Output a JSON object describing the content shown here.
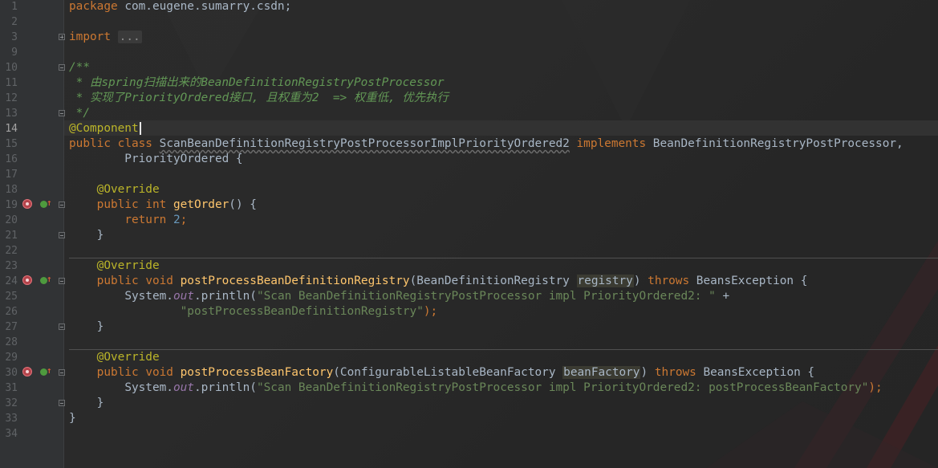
{
  "editor": {
    "current_line": 14,
    "line_numbers": [
      "1",
      "2",
      "3",
      "9",
      "10",
      "11",
      "12",
      "13",
      "14",
      "15",
      "16",
      "17",
      "18",
      "19",
      "20",
      "21",
      "22",
      "23",
      "24",
      "25",
      "26",
      "27",
      "28",
      "29",
      "30",
      "31",
      "32",
      "33",
      "34"
    ],
    "lines": {
      "l1": {
        "kw": "package",
        "text": " com.eugene.sumarry.csdn;"
      },
      "l3": {
        "kw": "import",
        "folded": "..."
      },
      "l9": {
        "text": "/**"
      },
      "l10": {
        "a": " * 由",
        "b": "spring",
        "c": "扫描出来的",
        "d": "BeanDefinitionRegistryPostProcessor"
      },
      "l11": {
        "a": " * 实现了",
        "b": "PriorityOrdered",
        "c": "接口, 且权重为",
        "d": "2",
        "e": "  => 权重低, 优先执行"
      },
      "l12": {
        "text": " */"
      },
      "l13": {
        "ann": "@Component"
      },
      "l14": {
        "kw1": "public",
        "kw2": "class",
        "cls": "ScanBeanDefinitionRegistryPostProcessorImplPriorityOrdered2",
        "kw3": "implements",
        "rest": " BeanDefinitionRegistryPostProcessor,"
      },
      "l15": {
        "text": "        PriorityOrdered {"
      },
      "l17": {
        "ann": "@Override"
      },
      "l18": {
        "kw1": "public",
        "kw2": "int",
        "fn": "getOrder",
        "rest": "() {"
      },
      "l19": {
        "kw": "return",
        "num": "2",
        "rest": ";"
      },
      "l20": {
        "text": "}"
      },
      "l22": {
        "ann": "@Override"
      },
      "l23": {
        "kw1": "public",
        "kw2": "void",
        "fn": "postProcessBeanDefinitionRegistry",
        "p1": "(BeanDefinitionRegistry ",
        "param": "registry",
        "p2": ")",
        "kw3": "throws",
        "rest": " BeansException {"
      },
      "l24": {
        "a": "System.",
        "b": "out",
        "c": ".println(",
        "str": "\"Scan BeanDefinitionRegistryPostProcessor impl PriorityOrdered2: \"",
        "rest": " +"
      },
      "l25": {
        "str": "\"postProcessBeanDefinitionRegistry\"",
        "rest": ");"
      },
      "l26": {
        "text": "}"
      },
      "l28": {
        "ann": "@Override"
      },
      "l29": {
        "kw1": "public",
        "kw2": "void",
        "fn": "postProcessBeanFactory",
        "p1": "(ConfigurableListableBeanFactory ",
        "param": "beanFactory",
        "p2": ")",
        "kw3": "throws",
        "rest": " BeansException {"
      },
      "l30": {
        "a": "System.",
        "b": "out",
        "c": ".println(",
        "str": "\"Scan BeanDefinitionRegistryPostProcessor impl PriorityOrdered2: postProcessBeanFactory\"",
        "rest": ");"
      },
      "l31": {
        "text": "}"
      },
      "l32": {
        "text": "}"
      }
    },
    "colors": {
      "background": "#2b2b2b",
      "keyword": "#cc7832",
      "annotation": "#bbb529",
      "method": "#ffc66d",
      "string": "#6a8759",
      "number": "#6897bb",
      "doc_comment": "#629755",
      "static_field": "#9876aa",
      "default_text": "#a9b7c6"
    },
    "gutter_icons": [
      "bean-icon",
      "implements-method-icon",
      "up-arrow-icon"
    ]
  }
}
